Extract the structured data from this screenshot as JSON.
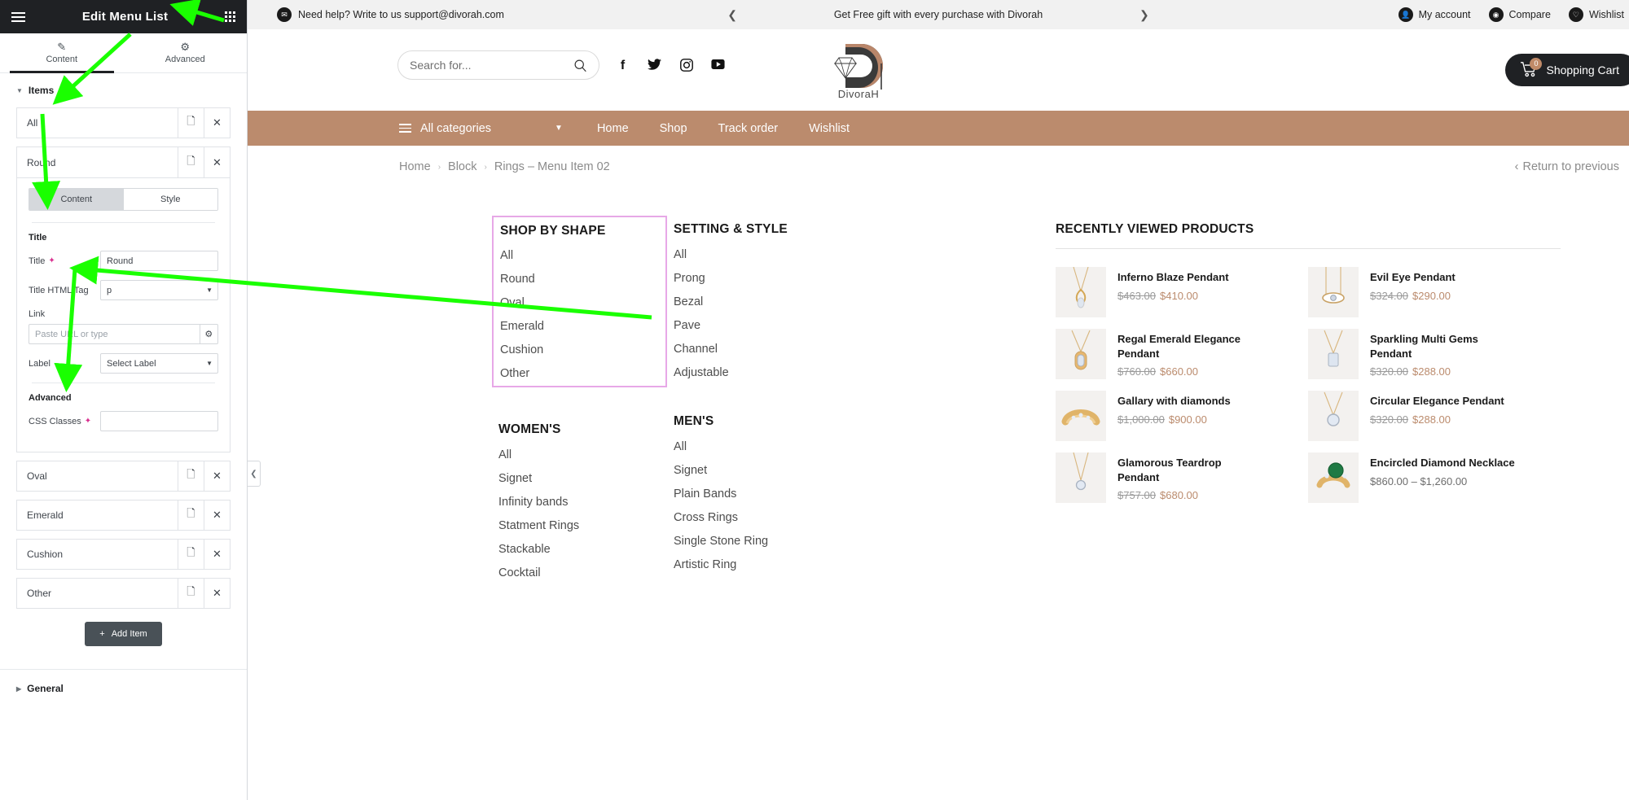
{
  "panel": {
    "title": "Edit Menu List",
    "menu_icon": "hamburger-icon",
    "apps_icon": "grid-icon",
    "tabs": [
      {
        "label": "Content",
        "icon": "pencil-icon",
        "active": true
      },
      {
        "label": "Advanced",
        "icon": "gear-icon",
        "active": false
      }
    ],
    "items_section": {
      "label": "Items"
    },
    "general_section": {
      "label": "General"
    },
    "repeater_items": [
      {
        "title": "All"
      },
      {
        "title": "Round"
      },
      {
        "title": "Oval"
      },
      {
        "title": "Emerald"
      },
      {
        "title": "Cushion"
      },
      {
        "title": "Other"
      }
    ],
    "open_item": {
      "title": "Round",
      "subtabs": [
        {
          "label": "Content",
          "active": true
        },
        {
          "label": "Style",
          "active": false
        }
      ],
      "title_group_label": "Title",
      "title_field_label": "Title",
      "title_field_value": "Round",
      "title_tag_label": "Title HTML Tag",
      "title_tag_value": "p",
      "link_label": "Link",
      "link_placeholder": "Paste URL or type",
      "link_gear_icon": "gear-icon",
      "label_label": "Label",
      "label_value": "Select Label",
      "advanced_label": "Advanced",
      "css_classes_label": "CSS Classes",
      "css_classes_value": ""
    },
    "row_icons": {
      "duplicate": "copy-icon",
      "remove": "close-icon"
    },
    "add_item_label": "Add Item",
    "add_item_icon": "plus-icon",
    "collapse_icon": "chevron-left-icon"
  },
  "site": {
    "topbar": {
      "help_icon": "envelope-icon",
      "help_text": "Need help? Write to us support@divorah.com",
      "prev_icon": "chevron-left-icon",
      "next_icon": "chevron-right-icon",
      "announcement": "Get Free gift with every purchase with Divorah",
      "links": [
        {
          "label": "My account",
          "icon": "user-icon"
        },
        {
          "label": "Compare",
          "icon": "compare-icon"
        },
        {
          "label": "Wishlist",
          "icon": "heart-icon"
        }
      ]
    },
    "header": {
      "search_placeholder": "Search for...",
      "search_icon": "search-icon",
      "socials": [
        {
          "name": "facebook-icon",
          "glyph": "f"
        },
        {
          "name": "twitter-icon",
          "glyph": "ᵗ"
        },
        {
          "name": "instagram-icon",
          "glyph": "□"
        },
        {
          "name": "youtube-icon",
          "glyph": "▶"
        }
      ],
      "logo_text": "DivoraH",
      "cart_label": "Shopping Cart",
      "cart_count": "0",
      "cart_icon": "cart-icon"
    },
    "nav": {
      "all_categories": "All categories",
      "burger_icon": "hamburger-icon",
      "chevron_icon": "chevron-down-icon",
      "links": [
        "Home",
        "Shop",
        "Track order",
        "Wishlist"
      ]
    },
    "breadcrumb": {
      "items": [
        "Home",
        "Block",
        "Rings – Menu Item 02"
      ],
      "separator": "›",
      "return_label": "Return to previous",
      "return_icon": "chevron-left-icon"
    },
    "mega_menu": {
      "columns": [
        {
          "heading": "SHOP BY SHAPE",
          "highlighted": true,
          "links": [
            "All",
            "Round",
            "Oval",
            "Emerald",
            "Cushion",
            "Other"
          ]
        },
        {
          "heading": "SETTING & STYLE",
          "highlighted": false,
          "links": [
            "All",
            "Prong",
            "Bezal",
            "Pave",
            "Channel",
            "Adjustable"
          ]
        },
        {
          "heading": "WOMEN'S",
          "highlighted": false,
          "links": [
            "All",
            "Signet",
            "Infinity bands",
            "Statment Rings",
            "Stackable",
            "Cocktail"
          ]
        },
        {
          "heading": "MEN'S",
          "highlighted": false,
          "links": [
            "All",
            "Signet",
            "Plain Bands",
            "Cross Rings",
            "Single Stone Ring",
            "Artistic Ring"
          ]
        }
      ],
      "highlight_color": "#e7a8e7"
    },
    "recently_viewed": {
      "heading": "RECENTLY VIEWED PRODUCTS",
      "products": [
        {
          "name": "Inferno Blaze Pendant",
          "old_price": "$463.00",
          "price": "$410.00",
          "thumb": "pendant-teardrop"
        },
        {
          "name": "Evil Eye Pendant",
          "old_price": "$324.00",
          "price": "$290.00",
          "thumb": "pendant-eye"
        },
        {
          "name": "Regal Emerald Elegance Pendant",
          "old_price": "$760.00",
          "price": "$660.00",
          "thumb": "pendant-emerald"
        },
        {
          "name": "Sparkling Multi Gems Pendant",
          "old_price": "$320.00",
          "price": "$288.00",
          "thumb": "pendant-gems"
        },
        {
          "name": "Gallary with diamonds",
          "old_price": "$1,000.00",
          "price": "$900.00",
          "thumb": "ring-diamonds"
        },
        {
          "name": "Circular Elegance Pendant",
          "old_price": "$320.00",
          "price": "$288.00",
          "thumb": "pendant-circular"
        },
        {
          "name": "Glamorous Teardrop Pendant",
          "old_price": "$757.00",
          "price": "$680.00",
          "thumb": "pendant-glam"
        },
        {
          "name": "Encircled Diamond Necklace",
          "old_price": "",
          "price": "$860.00 – $1,260.00",
          "thumb": "ring-emerald"
        }
      ]
    },
    "colors": {
      "nav_bg": "#bb8b6d",
      "accent": "#bb8b6d",
      "panel_dark": "#1f2124"
    }
  }
}
